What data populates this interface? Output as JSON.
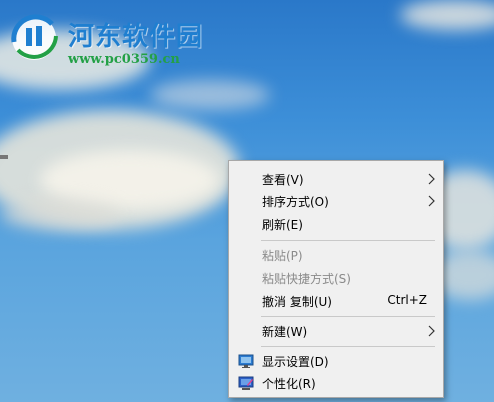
{
  "watermark": {
    "title": "河东软件园",
    "url": "www.pc0359.cn"
  },
  "context_menu": {
    "items": [
      {
        "label": "查看(V)",
        "submenu": true
      },
      {
        "label": "排序方式(O)",
        "submenu": true
      },
      {
        "label": "刷新(E)"
      },
      {
        "label": "粘贴(P)",
        "disabled": true
      },
      {
        "label": "粘贴快捷方式(S)",
        "disabled": true
      },
      {
        "label": "撤消 复制(U)",
        "shortcut": "Ctrl+Z"
      },
      {
        "label": "新建(W)",
        "submenu": true
      },
      {
        "label": "显示设置(D)",
        "icon": "display-settings-icon"
      },
      {
        "label": "个性化(R)",
        "icon": "personalize-icon"
      }
    ]
  },
  "colors": {
    "menu_background": "#f0f0f0",
    "disabled_text": "#8a8a8a",
    "watermark_title": "#1f7fd0",
    "watermark_url": "#23a046"
  }
}
